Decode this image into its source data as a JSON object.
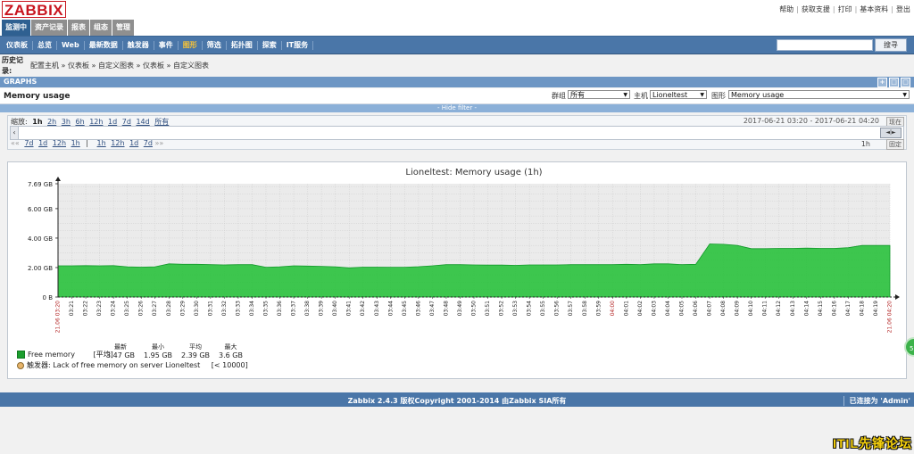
{
  "brand": {
    "logo": "ZABBIX"
  },
  "tabs": [
    {
      "label": "监测中",
      "active": true
    },
    {
      "label": "资产记录",
      "active": false
    },
    {
      "label": "报表",
      "active": false
    },
    {
      "label": "组态",
      "active": false
    },
    {
      "label": "管理",
      "active": false
    }
  ],
  "toplinks": [
    "帮助",
    "获取支援",
    "打印",
    "基本资料",
    "登出"
  ],
  "mainnav": [
    {
      "label": "仪表板",
      "active": false
    },
    {
      "label": "总览",
      "active": false
    },
    {
      "label": "Web",
      "active": false
    },
    {
      "label": "最新数据",
      "active": false
    },
    {
      "label": "触发器",
      "active": false
    },
    {
      "label": "事件",
      "active": false
    },
    {
      "label": "图形",
      "active": true
    },
    {
      "label": "筛选",
      "active": false
    },
    {
      "label": "拓扑图",
      "active": false
    },
    {
      "label": "探索",
      "active": false
    },
    {
      "label": "IT服务",
      "active": false
    }
  ],
  "search": {
    "button": "搜寻",
    "value": ""
  },
  "history": {
    "label": "历史记录:",
    "crumbs": [
      "配置主机",
      "仪表板",
      "自定义图表",
      "仪表板",
      "自定义图表"
    ],
    "sep": "»"
  },
  "section": {
    "title": "GRAPHS",
    "ctrl_icons": [
      "+",
      "□",
      "▢"
    ]
  },
  "filter": {
    "graph_name": "Memory usage",
    "group_label": "群组",
    "group_value": "所有",
    "host_label": "主机",
    "host_value": "Lioneltest",
    "graph_label": "图形",
    "graph_value": "Memory usage",
    "hide_filter": "- Hide filter -"
  },
  "timebar": {
    "zoom_label": "缩放:",
    "zoom": [
      {
        "label": "1h",
        "current": true
      },
      {
        "label": "2h",
        "current": false
      },
      {
        "label": "3h",
        "current": false
      },
      {
        "label": "6h",
        "current": false
      },
      {
        "label": "12h",
        "current": false
      },
      {
        "label": "1d",
        "current": false
      },
      {
        "label": "7d",
        "current": false
      },
      {
        "label": "14d",
        "current": false
      },
      {
        "label": "所有",
        "current": false
      }
    ],
    "range_from": "2017-06-21 03:20",
    "range_sep": "-",
    "range_to": "2017-06-21 04:20",
    "now_btn": "现在",
    "back_prefix": "««",
    "back": [
      "7d",
      "1d",
      "12h",
      "1h"
    ],
    "pipe": "|",
    "fwd": [
      "1h",
      "12h",
      "1d",
      "7d"
    ],
    "fwd_suffix": "»»",
    "period": "1h",
    "fixed_btn": "固定",
    "left_arrow": "‹",
    "handle": "◄|►"
  },
  "chart_data": {
    "type": "area",
    "title": "Lioneltest: Memory usage (1h)",
    "ylim": [
      0,
      7.69
    ],
    "yticks": [
      {
        "v": 0,
        "label": "0 B"
      },
      {
        "v": 2,
        "label": "2.00 GB"
      },
      {
        "v": 4,
        "label": "4.00 GB"
      },
      {
        "v": 6,
        "label": "6.00 GB"
      },
      {
        "v": 7.69,
        "label": "7.69 GB"
      }
    ],
    "x_start_label": "21.06 03:20",
    "x_end_label": "21.06 04:20",
    "x_tick_labels": [
      "03:21",
      "03:22",
      "03:23",
      "03:24",
      "03:25",
      "03:26",
      "03:27",
      "03:28",
      "03:29",
      "03:30",
      "03:31",
      "03:32",
      "03:33",
      "03:34",
      "03:35",
      "03:36",
      "03:37",
      "03:38",
      "03:39",
      "03:40",
      "03:41",
      "03:42",
      "03:43",
      "03:44",
      "03:45",
      "03:46",
      "03:47",
      "03:48",
      "03:49",
      "03:50",
      "03:51",
      "03:52",
      "03:53",
      "03:54",
      "03:55",
      "03:56",
      "03:57",
      "03:58",
      "03:59",
      "04:00",
      "04:01",
      "04:02",
      "04:03",
      "04:04",
      "04:05",
      "04:06",
      "04:07",
      "04:08",
      "04:09",
      "04:10",
      "04:11",
      "04:12",
      "04:13",
      "04:14",
      "04:15",
      "04:16",
      "04:17",
      "04:18",
      "04:19"
    ],
    "red_tick_labels": [
      "04:00"
    ],
    "series": [
      {
        "name": "Free memory",
        "color": "#1fbf32",
        "values": [
          2.12,
          2.12,
          2.13,
          2.12,
          2.13,
          2.05,
          2.03,
          2.05,
          2.25,
          2.22,
          2.22,
          2.2,
          2.18,
          2.2,
          2.2,
          2.02,
          2.05,
          2.12,
          2.1,
          2.08,
          2.05,
          1.98,
          2.03,
          2.03,
          2.02,
          2.02,
          2.06,
          2.12,
          2.2,
          2.2,
          2.18,
          2.17,
          2.17,
          2.15,
          2.18,
          2.18,
          2.18,
          2.2,
          2.2,
          2.2,
          2.2,
          2.22,
          2.2,
          2.25,
          2.25,
          2.2,
          2.22,
          3.6,
          3.58,
          3.5,
          3.28,
          3.28,
          3.3,
          3.3,
          3.32,
          3.3,
          3.3,
          3.35,
          3.5,
          3.5,
          3.5
        ]
      }
    ],
    "legend": [
      {
        "name": "Free memory",
        "agg": "[平均]",
        "stats": [
          {
            "h": "最新",
            "v": "3.47 GB"
          },
          {
            "h": "最小",
            "v": "1.95 GB"
          },
          {
            "h": "平均",
            "v": "2.39 GB"
          },
          {
            "h": "最大",
            "v": "3.6 GB"
          }
        ]
      }
    ],
    "trigger": {
      "prefix": "触发器:",
      "text": "Lack of free memory on server Lioneltest",
      "cond": "[< 10000]"
    },
    "grid": true
  },
  "footer": {
    "copyright": "Zabbix 2.4.3 版权Copyright 2001-2014 由Zabbix SIA所有",
    "login": "已连接为 'Admin'"
  },
  "watermark": "ITIL先锋论坛",
  "colors": {
    "nav": "#4a76a8",
    "accent": "#f3c13a",
    "series": "#1fbf32"
  }
}
